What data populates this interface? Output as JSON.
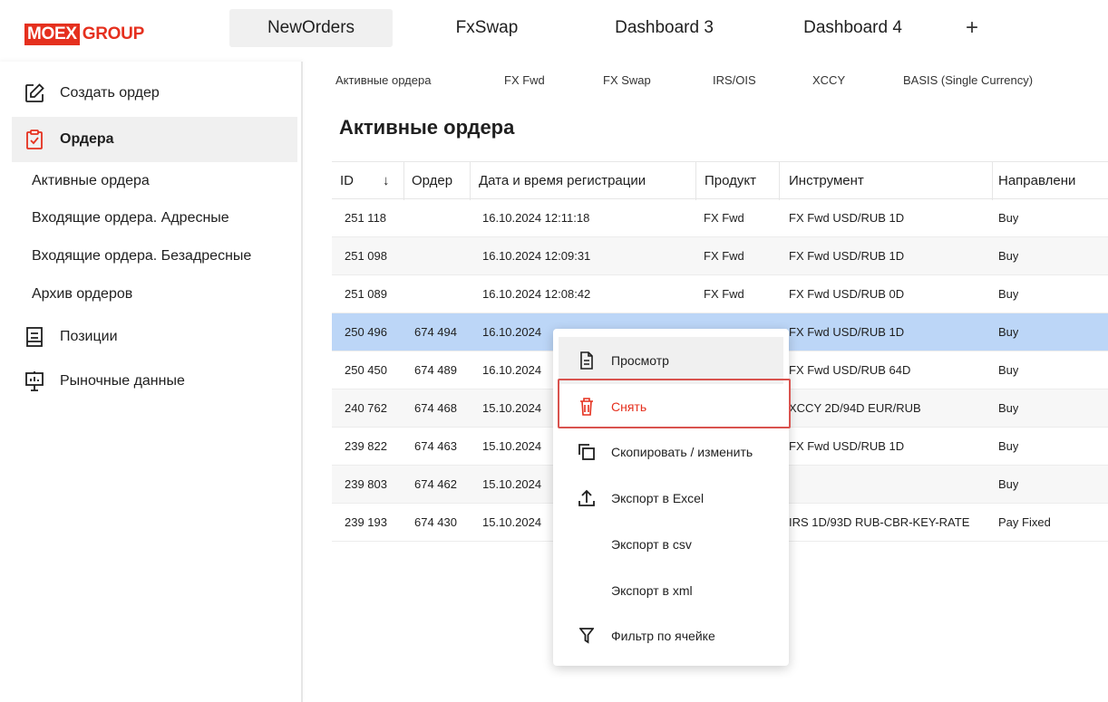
{
  "logo": {
    "box": "MOEX",
    "text": "GROUP"
  },
  "tabs": [
    {
      "label": "NewOrders",
      "active": true
    },
    {
      "label": "FxSwap",
      "active": false
    },
    {
      "label": "Dashboard 3",
      "active": false
    },
    {
      "label": "Dashboard 4",
      "active": false
    }
  ],
  "tab_add": "+",
  "sidebar": {
    "create_order": "Создать ордер",
    "orders": "Ордера",
    "sub": [
      "Активные ордера",
      "Входящие ордера. Адресные",
      "Входящие ордера. Безадресные",
      "Архив ордеров"
    ],
    "positions": "Позиции",
    "market_data": "Рыночные данные"
  },
  "subtabs": [
    "Активные ордера",
    "FX Fwd",
    "FX Swap",
    "IRS/OIS",
    "XCCY",
    "BASIS (Single Currency)"
  ],
  "page_title": "Активные ордера",
  "table": {
    "headers": [
      "ID",
      "Ордер",
      "Дата и время регистрации",
      "Продукт",
      "Инструмент",
      "Направлени"
    ],
    "sort_arrow": "↓",
    "rows": [
      [
        "251 118",
        "",
        "16.10.2024 12:11:18",
        "FX Fwd",
        "FX Fwd USD/RUB 1D",
        "Buy"
      ],
      [
        "251 098",
        "",
        "16.10.2024 12:09:31",
        "FX Fwd",
        "FX Fwd USD/RUB 1D",
        "Buy"
      ],
      [
        "251 089",
        "",
        "16.10.2024 12:08:42",
        "FX Fwd",
        "FX Fwd USD/RUB 0D",
        "Buy"
      ],
      [
        "250 496",
        "674 494",
        "16.10.2024",
        "",
        "FX Fwd USD/RUB 1D",
        "Buy"
      ],
      [
        "250 450",
        "674 489",
        "16.10.2024",
        "",
        "FX Fwd USD/RUB 64D",
        "Buy"
      ],
      [
        "240 762",
        "674 468",
        "15.10.2024",
        "",
        "XCCY 2D/94D EUR/RUB",
        "Buy"
      ],
      [
        "239 822",
        "674 463",
        "15.10.2024",
        "",
        "FX Fwd USD/RUB 1D",
        "Buy"
      ],
      [
        "239 803",
        "674 462",
        "15.10.2024",
        "",
        "",
        "Buy"
      ],
      [
        "239 193",
        "674 430",
        "15.10.2024",
        "",
        "IRS 1D/93D RUB-CBR-KEY-RATE",
        "Pay Fixed"
      ]
    ]
  },
  "context_menu": [
    {
      "label": "Просмотр",
      "icon": "document-icon"
    },
    {
      "label": "Снять",
      "icon": "trash-icon"
    },
    {
      "label": "Скопировать / изменить",
      "icon": "copy-icon"
    },
    {
      "label": "Экспорт в Excel",
      "icon": "upload-icon"
    },
    {
      "label": "Экспорт в csv",
      "icon": ""
    },
    {
      "label": "Экспорт в xml",
      "icon": ""
    },
    {
      "label": "Фильтр по ячейке",
      "icon": "filter-icon"
    }
  ],
  "colors": {
    "brand": "#e5301e",
    "selected_row": "#bcd6f7",
    "danger": "#e5301e"
  }
}
